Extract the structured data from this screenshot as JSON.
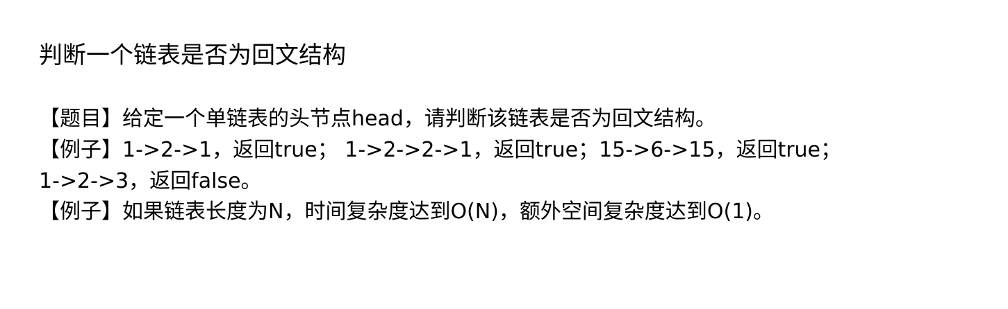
{
  "document": {
    "title": "判断一个链表是否为回文结构",
    "lines": [
      "【题目】给定一个单链表的头节点head，请判断该链表是否为回文结构。",
      "【例子】1->2->1，返回true； 1->2->2->1，返回true；15->6->15，返回true；",
      "1->2->3，返回false。",
      "【例子】如果链表长度为N，时间复杂度达到O(N)，额外空间复杂度达到O(1)。"
    ]
  }
}
